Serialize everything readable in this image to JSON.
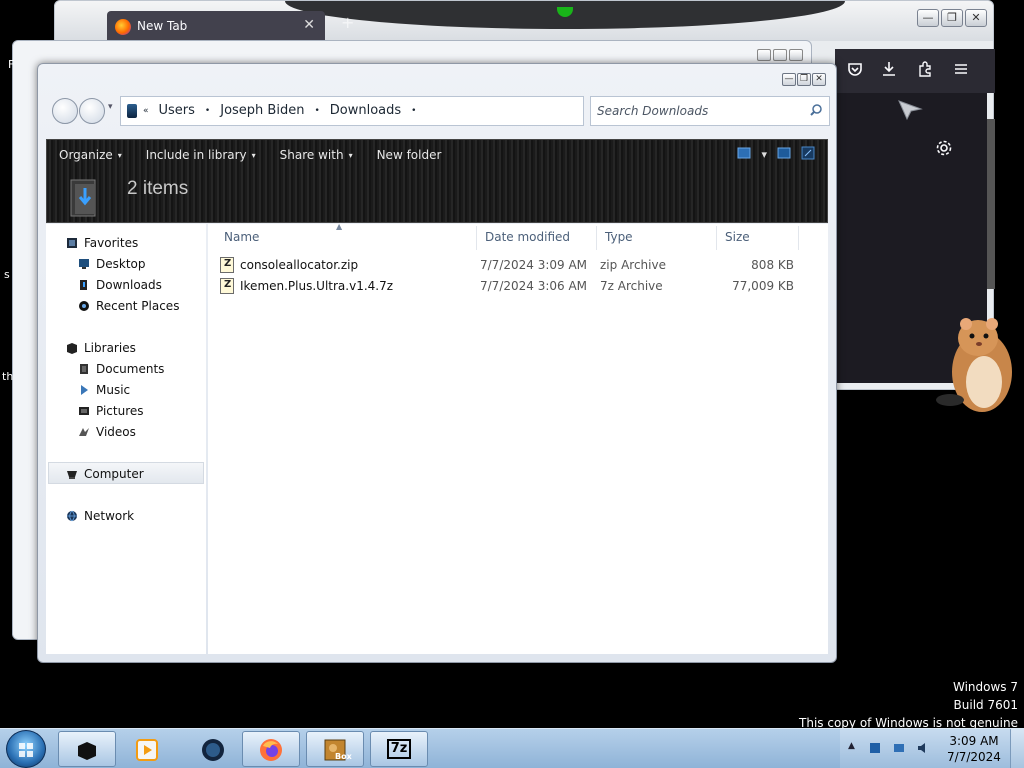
{
  "firefox": {
    "tab_title": "New Tab",
    "tab_close": "✕",
    "new_tab_plus": "+",
    "toolbar_icons": [
      "pocket-icon",
      "download-icon",
      "extensions-icon",
      "menu-icon"
    ],
    "settings_icon": "gear-icon",
    "window_buttons": [
      "—",
      "❐",
      "✕"
    ]
  },
  "explorer": {
    "window_buttons": [
      "—",
      "❐",
      "✕"
    ],
    "breadcrumb": [
      "Users",
      "Joseph Biden",
      "Downloads"
    ],
    "crumb_sep": "•",
    "search_placeholder": "Search Downloads",
    "toolbar": {
      "organize": "Organize",
      "include_in_library": "Include in library",
      "share_with": "Share with",
      "new_folder": "New folder",
      "arrow": "▾"
    },
    "item_count": "2 items",
    "nav": {
      "favorites": "Favorites",
      "favorites_items": [
        "Desktop",
        "Downloads",
        "Recent Places"
      ],
      "libraries": "Libraries",
      "libraries_items": [
        "Documents",
        "Music",
        "Pictures",
        "Videos"
      ],
      "computer": "Computer",
      "network": "Network"
    },
    "columns": [
      "Name",
      "Date modified",
      "Type",
      "Size"
    ],
    "files": [
      {
        "name": "consoleallocator.zip",
        "date": "7/7/2024 3:09 AM",
        "type": "zip Archive",
        "size": "808 KB"
      },
      {
        "name": "Ikemen.Plus.Ultra.v1.4.7z",
        "date": "7/7/2024 3:06 AM",
        "type": "7z Archive",
        "size": "77,009 KB"
      }
    ]
  },
  "edge_text": {
    "a": "F",
    "b": "s",
    "c": "th"
  },
  "watermark": {
    "line1": "Windows 7",
    "line2": "Build 7601",
    "line3": "This copy of Windows is not genuine"
  },
  "taskbar": {
    "apps": [
      "explorer-app",
      "media-player-app",
      "firefox-dark-app",
      "firefox-app",
      "box-app",
      "7zip-app"
    ],
    "box_label": "Box",
    "sevenzip_label": "7z",
    "clock_time": "3:09 AM",
    "clock_date": "7/7/2024",
    "tray_arrow": "▲"
  },
  "colors": {
    "accent": "#4a88c8",
    "cmdbar_bg": "#1b1b1b",
    "taskbar": "#a9c6e3"
  }
}
